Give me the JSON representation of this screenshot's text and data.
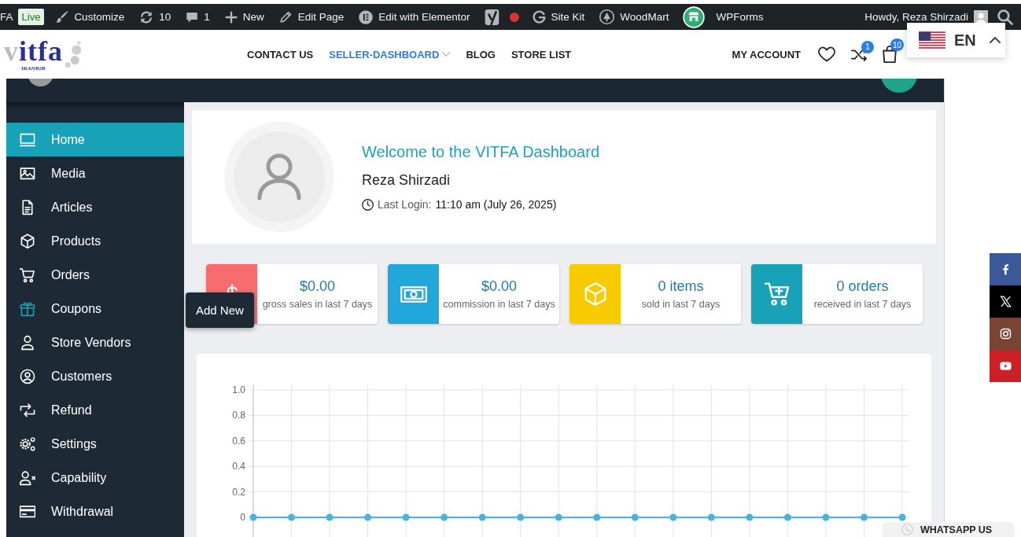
{
  "admin_bar": {
    "items": [
      {
        "kind": "text",
        "label": "FA"
      },
      {
        "kind": "badge",
        "label": "Live"
      },
      {
        "kind": "link",
        "label": "Customize"
      },
      {
        "kind": "link",
        "label": "10"
      },
      {
        "kind": "link",
        "label": "1"
      },
      {
        "kind": "link",
        "label": "New"
      },
      {
        "kind": "link",
        "label": "Edit Page"
      },
      {
        "kind": "link",
        "label": "Edit with Elementor"
      },
      {
        "kind": "seo_indicator"
      },
      {
        "kind": "link",
        "label": "Site Kit"
      },
      {
        "kind": "link",
        "label": "WoodMart"
      },
      {
        "kind": "icon_link"
      },
      {
        "kind": "link",
        "label": "WPForms"
      }
    ],
    "greeting": "Howdy, Reza Shirzadi"
  },
  "site_header": {
    "logo": {
      "text": "vitfa",
      "tagline": "IRANB2B"
    },
    "nav": [
      {
        "label": "CONTACT US",
        "selected": false,
        "submenu": false
      },
      {
        "label": "SELLER-DASHBOARD",
        "selected": true,
        "submenu": true
      },
      {
        "label": "BLOG",
        "selected": false,
        "submenu": false
      },
      {
        "label": "STORE LIST",
        "selected": false,
        "submenu": false
      }
    ],
    "account_link": "MY ACCOUNT",
    "compare_count": "1",
    "cart_count": "10"
  },
  "language_switcher": {
    "code": "EN",
    "expanded": true
  },
  "sidebar": {
    "items": [
      {
        "label": "Home",
        "selected": true,
        "hovered": false
      },
      {
        "label": "Media",
        "selected": false,
        "hovered": false
      },
      {
        "label": "Articles",
        "selected": false,
        "hovered": false
      },
      {
        "label": "Products",
        "selected": false,
        "hovered": false
      },
      {
        "label": "Orders",
        "selected": false,
        "hovered": false
      },
      {
        "label": "Coupons",
        "selected": false,
        "hovered": true
      },
      {
        "label": "Store Vendors",
        "selected": false,
        "hovered": false
      },
      {
        "label": "Customers",
        "selected": false,
        "hovered": false
      },
      {
        "label": "Refund",
        "selected": false,
        "hovered": false
      },
      {
        "label": "Settings",
        "selected": false,
        "hovered": false
      },
      {
        "label": "Capability",
        "selected": false,
        "hovered": false
      },
      {
        "label": "Withdrawal",
        "selected": false,
        "hovered": false
      }
    ],
    "tooltip": "Add New"
  },
  "welcome": {
    "title": "Welcome to the VITFA Dashboard",
    "user_name": "Reza Shirzadi",
    "last_login_label": "Last Login:",
    "last_login_value": "11:10 am (July 26, 2025)"
  },
  "stats": [
    {
      "value": "$0.00",
      "caption": "gross sales in last 7 days",
      "color": "#f76c6c"
    },
    {
      "value": "$0.00",
      "caption": "commission in last 7 days",
      "color": "#22a7da"
    },
    {
      "value": "0 items",
      "caption": "sold in last 7 days",
      "color": "#f7cb00"
    },
    {
      "value": "0 orders",
      "caption": "received in last 7 days",
      "color": "#17a2b8"
    }
  ],
  "sales_chart": {
    "chart_data": {
      "type": "line",
      "grid": true,
      "ylim": [
        0,
        1
      ],
      "yticks": [
        0,
        0.2,
        0.4,
        0.6,
        0.8,
        {
          "value": 1,
          "label": "1.0"
        }
      ],
      "series": [
        {
          "color": "#4ab3dc",
          "marker": "circle",
          "values": [
            0,
            0,
            0,
            0,
            0,
            0,
            0,
            0,
            0,
            0,
            0,
            0,
            0,
            0,
            0,
            0,
            0,
            0
          ]
        }
      ]
    }
  },
  "social_links": [
    {
      "color": "#3b5998"
    },
    {
      "color": "#000000"
    },
    {
      "color": "#7a4434"
    },
    {
      "color": "#cc2027"
    }
  ],
  "whatsapp_button": {
    "label": "WHATSAPP US"
  }
}
